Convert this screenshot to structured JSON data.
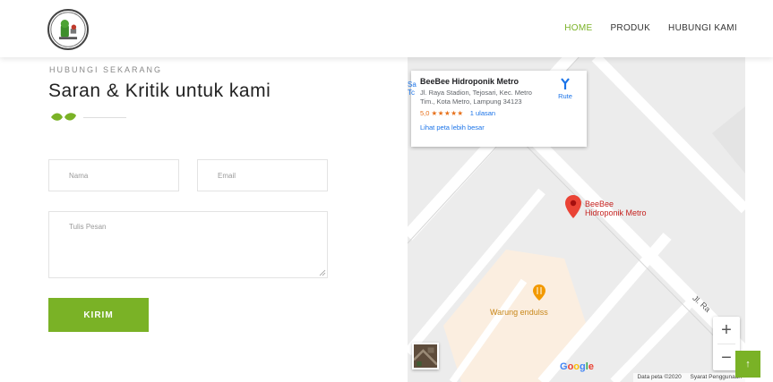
{
  "header": {
    "nav": [
      {
        "label": "HOME",
        "active": true
      },
      {
        "label": "PRODUK",
        "active": false
      },
      {
        "label": "HUBUNGI KAMI",
        "active": false
      }
    ]
  },
  "contact": {
    "eyebrow": "HUBUNGI SEKARANG",
    "title": "Saran & Kritik untuk kami",
    "name_placeholder": "Nama",
    "email_placeholder": "Email",
    "message_placeholder": "Tulis Pesan",
    "submit_label": "KIRIM"
  },
  "map": {
    "card": {
      "title": "BeeBee Hidroponik Metro",
      "address": "Jl. Raya Stadion, Tejosari, Kec. Metro Tim., Kota Metro, Lampung 34123",
      "rating": "5,0",
      "stars": "★★★★★",
      "reviews": "1 ulasan",
      "larger_map": "Lihat peta lebih besar",
      "route_label": "Rute"
    },
    "place_label_line1": "BeeBee",
    "place_label_line2": "Hidroponik Metro",
    "restaurant_label": "Warung endulss",
    "street_label": "Jl. Ra",
    "side_label_1": "Sa",
    "side_label_2": "Tc",
    "zoom_in": "+",
    "zoom_out": "−",
    "google": "Google",
    "footer_data": "Data peta ©2020",
    "footer_terms": "Syarat Penggunaan"
  },
  "scroll_top_label": "↑",
  "colors": {
    "accent": "#7ab226",
    "pin": "#ea4335",
    "link": "#1a73e8"
  }
}
